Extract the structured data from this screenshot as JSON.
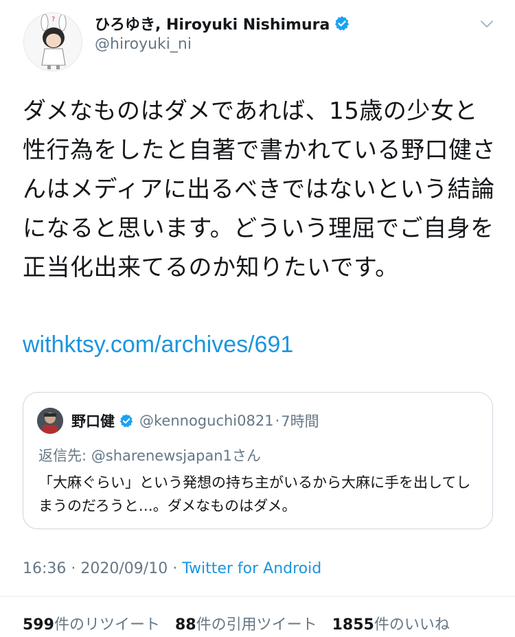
{
  "author": {
    "display_name": "ひろゆき, Hiroyuki Nishimura",
    "handle": "@hiroyuki_ni",
    "verified": true
  },
  "tweet": {
    "text": "ダメなものはダメであれば、15歳の少女と性行為をしたと自著で書かれている野口健さんはメディアに出るべきではないという結論になると思います。どういう理屈でご自身を正当化出来てるのか知りたいです。",
    "link": "withktsy.com/archives/691"
  },
  "quoted": {
    "name": "野口健",
    "verified": true,
    "handle": "@kennoguchi0821",
    "separator": "·",
    "time": "7時間",
    "reply_to": "返信先: @sharenewsjapan1さん",
    "text": "「大麻ぐらい」という発想の持ち主がいるから大麻に手を出してしまうのだろうと…。ダメなものはダメ。"
  },
  "meta": {
    "time": "16:36",
    "separator1": " · ",
    "date": "2020/09/10",
    "separator2": " · ",
    "source": "Twitter for Android"
  },
  "stats": {
    "retweets": {
      "count": "599",
      "label": "件のリツイート"
    },
    "quotes": {
      "count": "88",
      "label": "件の引用ツイート"
    },
    "likes": {
      "count": "1855",
      "label": "件のいいね"
    }
  },
  "colors": {
    "link_blue": "#1b95e0",
    "verified_blue": "#1da1f2",
    "secondary_text": "#657786",
    "border": "#ccd6dd"
  },
  "icons": {
    "verified": "verified-badge-icon",
    "caret": "chevron-down-icon"
  }
}
